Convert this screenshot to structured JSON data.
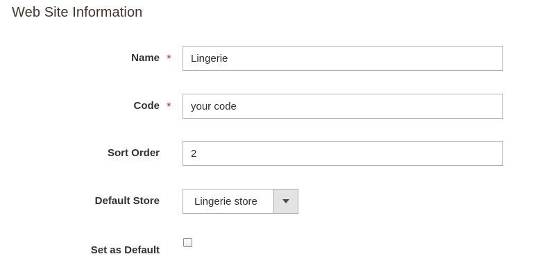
{
  "section": {
    "title": "Web Site Information"
  },
  "fields": {
    "name": {
      "label": "Name",
      "required_mark": "*",
      "value": "Lingerie"
    },
    "code": {
      "label": "Code",
      "required_mark": "*",
      "value": "your code"
    },
    "sort_order": {
      "label": "Sort Order",
      "value": "2"
    },
    "default_store": {
      "label": "Default Store",
      "selected": "Lingerie store",
      "icon": "chevron-down-icon"
    },
    "set_as_default": {
      "label": "Set as Default",
      "checked": false
    }
  },
  "colors": {
    "required": "#e22626",
    "border": "#adadad",
    "select_toggle_bg": "#e3e3e3",
    "title": "#41362f"
  }
}
